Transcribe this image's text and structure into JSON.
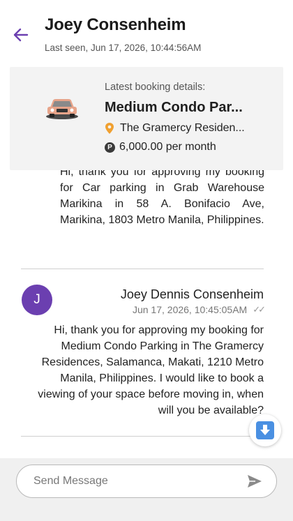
{
  "header": {
    "contact_name": "Joey Consenheim",
    "last_seen": "Last seen, Jun 17, 2026, 10:44:56AM"
  },
  "booking": {
    "caption": "Latest booking details:",
    "title": "Medium Condo Par...",
    "location": "The Gramercy Residen...",
    "price": "6,000.00 per month",
    "price_symbol": "P"
  },
  "messages": {
    "previous": {
      "text": "Hi, thank you for approving my booking for Car parking in Grab Warehouse Marikina in 58 A. Bonifacio Ave, Marikina, 1803 Metro Manila, Philippines."
    },
    "latest": {
      "avatar_initial": "J",
      "sender": "Joey Dennis Consenheim",
      "time": "Jun 17, 2026, 10:45:05AM",
      "status_icon": "double-check-icon",
      "text": "Hi, thank you for approving my booking for Medium Condo Parking in The Gramercy Residences, Salamanca, Makati, 1210 Metro Manila, Philippines. I would like to book a viewing of your space before moving in, when will you be available?"
    }
  },
  "composer": {
    "placeholder": "Send Message"
  },
  "colors": {
    "accent": "#6b3fb0",
    "pin": "#f0a030",
    "scroll_button": "#4a90e2"
  }
}
